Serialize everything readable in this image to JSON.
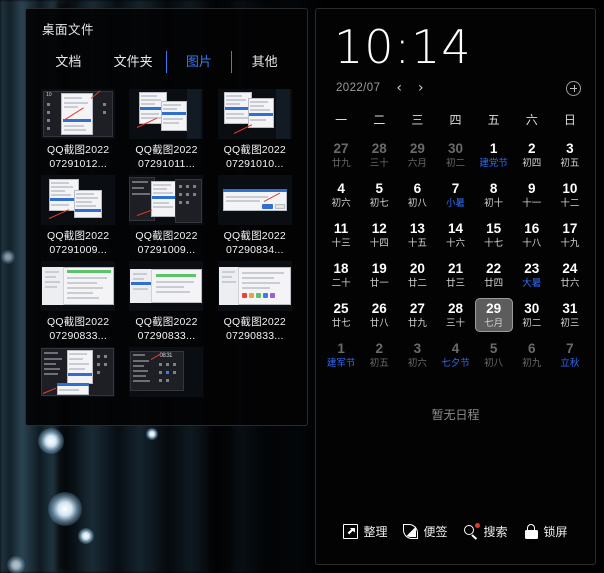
{
  "wallpaper": {
    "bokeh_count": 6
  },
  "files_panel": {
    "title": "桌面文件",
    "tabs": [
      {
        "label": "文档",
        "active": false
      },
      {
        "label": "文件夹",
        "active": false
      },
      {
        "label": "图片",
        "active": true
      },
      {
        "label": "其他",
        "active": false
      }
    ],
    "files": [
      {
        "name": "QQ截图2022\n07291012...",
        "thumb": "menu-dark"
      },
      {
        "name": "QQ截图2022\n07291011...",
        "thumb": "menu-light"
      },
      {
        "name": "QQ截图2022\n07291010...",
        "thumb": "menu-light2"
      },
      {
        "name": "QQ截图2022\n07291009...",
        "thumb": "menu-light3"
      },
      {
        "name": "QQ截图2022\n07291009...",
        "thumb": "dark-panel"
      },
      {
        "name": "QQ截图2022\n07290834...",
        "thumb": "dialog"
      },
      {
        "name": "QQ截图2022\n07290833...",
        "thumb": "settings"
      },
      {
        "name": "QQ截图2022\n07290833...",
        "thumb": "settings2"
      },
      {
        "name": "QQ截图2022\n07290833...",
        "thumb": "settings3"
      },
      {
        "name": "",
        "thumb": "explorer"
      },
      {
        "name": "",
        "thumb": "dark-explorer"
      },
      {
        "name": "",
        "thumb": ""
      }
    ]
  },
  "calendar_panel": {
    "clock": "10:14",
    "year_month": "2022/07",
    "prev_label": "‹",
    "next_label": "›",
    "add_label": "+",
    "weekdays": [
      "一",
      "二",
      "三",
      "四",
      "五",
      "六",
      "日"
    ],
    "days": [
      {
        "n": "27",
        "l": "廿九",
        "other": true,
        "fest": false,
        "today": false
      },
      {
        "n": "28",
        "l": "三十",
        "other": true,
        "fest": false,
        "today": false
      },
      {
        "n": "29",
        "l": "六月",
        "other": true,
        "fest": false,
        "today": false
      },
      {
        "n": "30",
        "l": "初二",
        "other": true,
        "fest": false,
        "today": false
      },
      {
        "n": "1",
        "l": "建党节",
        "other": false,
        "fest": true,
        "today": false
      },
      {
        "n": "2",
        "l": "初四",
        "other": false,
        "fest": false,
        "today": false
      },
      {
        "n": "3",
        "l": "初五",
        "other": false,
        "fest": false,
        "today": false
      },
      {
        "n": "4",
        "l": "初六",
        "other": false,
        "fest": false,
        "today": false
      },
      {
        "n": "5",
        "l": "初七",
        "other": false,
        "fest": false,
        "today": false
      },
      {
        "n": "6",
        "l": "初八",
        "other": false,
        "fest": false,
        "today": false
      },
      {
        "n": "7",
        "l": "小暑",
        "other": false,
        "fest": true,
        "today": false
      },
      {
        "n": "8",
        "l": "初十",
        "other": false,
        "fest": false,
        "today": false
      },
      {
        "n": "9",
        "l": "十一",
        "other": false,
        "fest": false,
        "today": false
      },
      {
        "n": "10",
        "l": "十二",
        "other": false,
        "fest": false,
        "today": false
      },
      {
        "n": "11",
        "l": "十三",
        "other": false,
        "fest": false,
        "today": false
      },
      {
        "n": "12",
        "l": "十四",
        "other": false,
        "fest": false,
        "today": false
      },
      {
        "n": "13",
        "l": "十五",
        "other": false,
        "fest": false,
        "today": false
      },
      {
        "n": "14",
        "l": "十六",
        "other": false,
        "fest": false,
        "today": false
      },
      {
        "n": "15",
        "l": "十七",
        "other": false,
        "fest": false,
        "today": false
      },
      {
        "n": "16",
        "l": "十八",
        "other": false,
        "fest": false,
        "today": false
      },
      {
        "n": "17",
        "l": "十九",
        "other": false,
        "fest": false,
        "today": false
      },
      {
        "n": "18",
        "l": "二十",
        "other": false,
        "fest": false,
        "today": false
      },
      {
        "n": "19",
        "l": "廿一",
        "other": false,
        "fest": false,
        "today": false
      },
      {
        "n": "20",
        "l": "廿二",
        "other": false,
        "fest": false,
        "today": false
      },
      {
        "n": "21",
        "l": "廿三",
        "other": false,
        "fest": false,
        "today": false
      },
      {
        "n": "22",
        "l": "廿四",
        "other": false,
        "fest": false,
        "today": false
      },
      {
        "n": "23",
        "l": "大暑",
        "other": false,
        "fest": true,
        "today": false
      },
      {
        "n": "24",
        "l": "廿六",
        "other": false,
        "fest": false,
        "today": false
      },
      {
        "n": "25",
        "l": "廿七",
        "other": false,
        "fest": false,
        "today": false
      },
      {
        "n": "26",
        "l": "廿八",
        "other": false,
        "fest": false,
        "today": false
      },
      {
        "n": "27",
        "l": "廿九",
        "other": false,
        "fest": false,
        "today": false
      },
      {
        "n": "28",
        "l": "三十",
        "other": false,
        "fest": false,
        "today": false
      },
      {
        "n": "29",
        "l": "七月",
        "other": false,
        "fest": false,
        "today": true
      },
      {
        "n": "30",
        "l": "初二",
        "other": false,
        "fest": false,
        "today": false
      },
      {
        "n": "31",
        "l": "初三",
        "other": false,
        "fest": false,
        "today": false
      },
      {
        "n": "1",
        "l": "建军节",
        "other": true,
        "fest": true,
        "today": false
      },
      {
        "n": "2",
        "l": "初五",
        "other": true,
        "fest": false,
        "today": false
      },
      {
        "n": "3",
        "l": "初六",
        "other": true,
        "fest": false,
        "today": false
      },
      {
        "n": "4",
        "l": "七夕节",
        "other": true,
        "fest": true,
        "today": false
      },
      {
        "n": "5",
        "l": "初八",
        "other": true,
        "fest": false,
        "today": false
      },
      {
        "n": "6",
        "l": "初九",
        "other": true,
        "fest": false,
        "today": false
      },
      {
        "n": "7",
        "l": "立秋",
        "other": true,
        "fest": true,
        "today": false
      }
    ],
    "schedule_empty": "暂无日程",
    "tools": [
      {
        "label": "整理",
        "icon": "tidy-icon"
      },
      {
        "label": "便签",
        "icon": "note-icon"
      },
      {
        "label": "搜索",
        "icon": "search-icon",
        "badge": true
      },
      {
        "label": "锁屏",
        "icon": "lock-icon"
      }
    ]
  },
  "colors": {
    "accent_blue": "#2f6bf0",
    "tab_active": "#3b7bf0",
    "panel_bg": "#030304",
    "today_bg": "#5c5c5c",
    "badge_red": "#e8342c"
  }
}
